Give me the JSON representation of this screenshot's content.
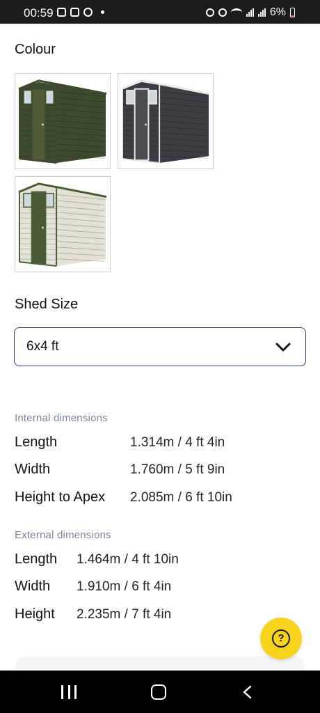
{
  "status_bar": {
    "time": "00:59",
    "battery_text": "6%",
    "left_icons": [
      "instagram-icon",
      "instagram-icon",
      "messenger-icon",
      "notification-dot-icon"
    ],
    "right_icons": [
      "clock-icon",
      "alarm-icon",
      "wifi-icon",
      "signal-icon",
      "signal-icon",
      "battery-icon"
    ]
  },
  "colour": {
    "title": "Colour",
    "options": [
      {
        "name": "green-shed",
        "body_color": "#3e4a2e",
        "door_color": "#4f5c37",
        "frame_color": "#3e4a2e"
      },
      {
        "name": "grey-shed",
        "body_color": "#3b3d40",
        "door_color": "#4a4c50",
        "frame_color": "#e8e8e8"
      },
      {
        "name": "cream-shed",
        "body_color": "#e3e2d4",
        "door_color": "#4a5a34",
        "frame_color": "#4a5a34"
      }
    ]
  },
  "shed_size": {
    "title": "Shed Size",
    "selected": "6x4 ft"
  },
  "internal": {
    "heading": "Internal dimensions",
    "rows": [
      {
        "label": "Length",
        "value": "1.314m / 4 ft 4in"
      },
      {
        "label": "Width",
        "value": "1.760m / 5 ft 9in"
      },
      {
        "label": "Height to Apex",
        "value": "2.085m / 6 ft 10in"
      }
    ]
  },
  "external": {
    "heading": "External dimensions",
    "rows": [
      {
        "label": "Length",
        "value": "1.464m / 4 ft 10in"
      },
      {
        "label": "Width",
        "value": "1.910m / 6 ft 4in"
      },
      {
        "label": "Height",
        "value": "2.235m / 7 ft 4in"
      }
    ]
  },
  "help": {
    "icon_text": "?",
    "color": "#f7d31d"
  },
  "accent_color": "#2a3f8f"
}
